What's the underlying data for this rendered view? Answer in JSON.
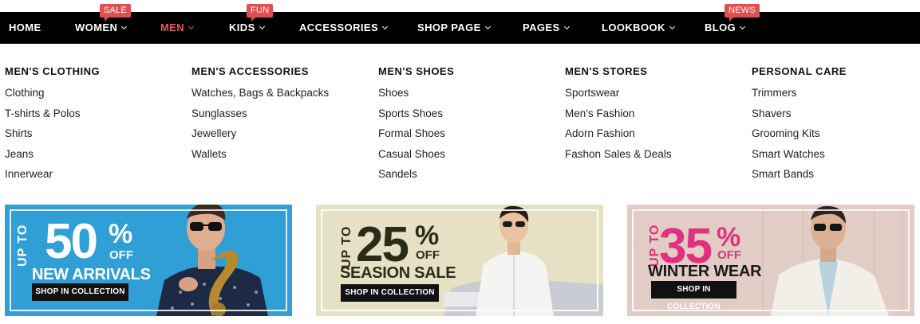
{
  "nav": {
    "items": [
      {
        "label": "HOME"
      },
      {
        "label": "WOMEN",
        "badge": "SALE"
      },
      {
        "label": "MEN"
      },
      {
        "label": "KIDS",
        "badge": "FUN"
      },
      {
        "label": "ACCESSORIES"
      },
      {
        "label": "SHOP PAGE"
      },
      {
        "label": "PAGES"
      },
      {
        "label": "LOOKBOOK"
      },
      {
        "label": "BLOG",
        "badge": "NEWS"
      }
    ],
    "active": "MEN",
    "colors": {
      "bar": "#000000",
      "active": "#e85a5a",
      "badge": "#e05050"
    }
  },
  "menu": {
    "columns": [
      {
        "title": "MEN'S CLOTHING",
        "items": [
          "Clothing",
          "T-shirts & Polos",
          "Shirts",
          "Jeans",
          "Innerwear"
        ]
      },
      {
        "title": "MEN'S ACCESSORIES",
        "items": [
          "Watches, Bags & Backpacks",
          "Sunglasses",
          "Jewellery",
          "Wallets"
        ]
      },
      {
        "title": "MEN'S SHOES",
        "items": [
          "Shoes",
          "Sports Shoes",
          "Formal Shoes",
          "Casual Shoes",
          "Sandels"
        ]
      },
      {
        "title": "MEN'S STORES",
        "items": [
          "Sportswear",
          "Men's Fashion",
          "Adorn Fashion",
          "Fashon Sales & Deals"
        ]
      },
      {
        "title": "PERSONAL CARE",
        "items": [
          "Trimmers",
          "Shavers",
          "Grooming Kits",
          "Smart Watches",
          "Smart Bands"
        ]
      }
    ]
  },
  "banners": [
    {
      "upto": "UP TO",
      "percent": "50",
      "pct_sign": "%",
      "off": "OFF",
      "headline": "NEW ARRIVALS",
      "button": "SHOP IN COLLECTION",
      "background": "#2f9fd6",
      "text_color": "#ffffff",
      "percent_color": "#ffffff"
    },
    {
      "upto": "UP TO",
      "percent": "25",
      "pct_sign": "%",
      "off": "OFF",
      "headline": "SEASION SALE",
      "button": "SHOP IN COLLECTION",
      "background": "#e6e1c4",
      "text_color": "#2b2b1a",
      "percent_color": "#2b2b1a"
    },
    {
      "upto": "UP TO",
      "percent": "35",
      "pct_sign": "%",
      "off": "OFF",
      "headline": "WINTER WEAR",
      "button": "SHOP IN COLLECTION",
      "background": "#e2ccc6",
      "text_color": "#1a1a1a",
      "percent_color": "#e0307e"
    }
  ]
}
